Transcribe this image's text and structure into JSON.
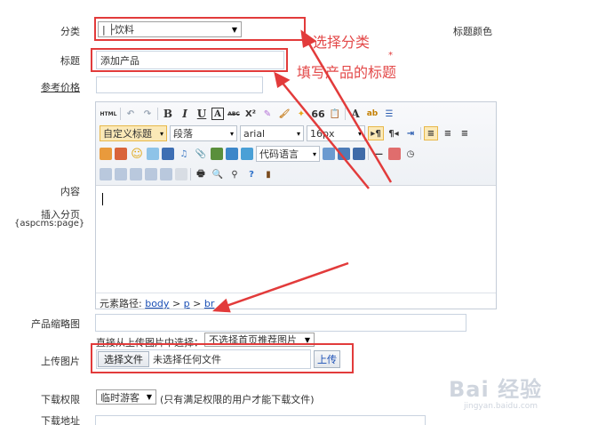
{
  "form": {
    "category_label": "分类",
    "category_value": "| ├饮料",
    "title_label": "标题",
    "title_value": "添加产品",
    "title_color_label": "标题颜色",
    "required_mark": "*",
    "price_label": "参考价格",
    "content_label": "内容",
    "pagebreak_label": "插入分页",
    "pagebreak_tag": "{aspcms:page}",
    "thumb_label": "产品缩略图",
    "upload_pick_hint": "直接从上传图片中选择：",
    "upload_pick_select": "不选择首页推荐图片",
    "upload_label": "上传图片",
    "choose_file_button": "选择文件",
    "no_file_text": "未选择任何文件",
    "upload_button": "上传",
    "download_perm_label": "下载权限",
    "download_perm_value": "临时游客",
    "download_perm_hint": "(只有满足权限的用户才能下载文件)",
    "download_url_label": "下载地址"
  },
  "editor": {
    "style_select": "自定义标题",
    "paragraph_select": "段落",
    "font_select": "arial",
    "size_select": "16px",
    "code_select": "代码语言",
    "path_label": "元素路径:",
    "path_body": "body",
    "path_gt1": ">",
    "path_p": "p",
    "path_gt2": ">",
    "path_br": "br",
    "html_btn": "HTML",
    "bold": "B",
    "italic": "I",
    "underline": "U",
    "font_border": "A",
    "strike": "ABC",
    "superscript": "X²",
    "quote": "66",
    "font_color": "A"
  },
  "annotations": {
    "select_category": "选择分类",
    "fill_title": "填写产品的标题"
  },
  "watermark": {
    "brand": "Bai 经验",
    "url": "jingyan.baidu.com"
  },
  "colors": {
    "annotation_red": "#e23b3b",
    "link_blue": "#1a4fb5"
  }
}
